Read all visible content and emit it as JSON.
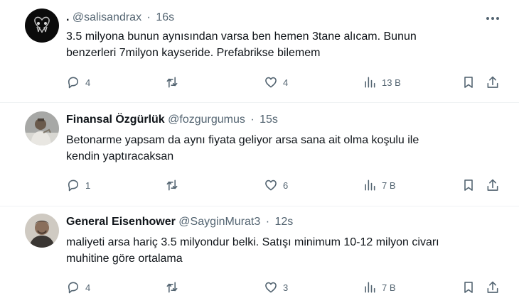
{
  "tweets": [
    {
      "display_name": ".",
      "handle": "@salisandrax",
      "time": "16s",
      "line1": "3.5 milyona bunun aynısından varsa ben hemen 3tane alıcam. Bunun",
      "line2": "benzerleri 7milyon kayseride. Prefabrikse bilemem",
      "replies": "4",
      "retweets": "",
      "likes": "4",
      "views": "13 B",
      "icons": [
        "more-icon",
        "reply-icon",
        "retweet-icon",
        "like-icon",
        "views-icon",
        "bookmark-icon",
        "share-icon"
      ]
    },
    {
      "display_name": "Finansal Özgürlük",
      "handle": "@fozgurgumus",
      "time": "15s",
      "line1": "Betonarme yapsam da aynı fiyata geliyor arsa sana ait olma koşulu ile",
      "line2": "kendin yaptıracaksan",
      "replies": "1",
      "retweets": "",
      "likes": "6",
      "views": "7 B"
    },
    {
      "display_name": "General Eisenhower",
      "handle": "@SayginMurat3",
      "time": "12s",
      "line1": "maliyeti arsa hariç 3.5 milyondur belki. Satışı minimum 10-12 milyon civarı",
      "line2": "muhitine göre ortalama",
      "replies": "4",
      "retweets": "",
      "likes": "3",
      "views": "7 B"
    }
  ],
  "colors": {
    "text": "#0f1419",
    "secondary": "#536471",
    "divider": "#eff3f4"
  }
}
